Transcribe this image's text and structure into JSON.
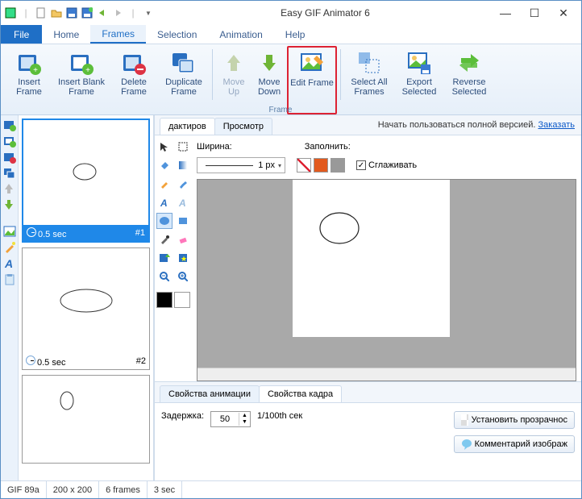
{
  "title": "Easy GIF Animator 6",
  "menu_tabs": {
    "file": "File",
    "home": "Home",
    "frames": "Frames",
    "selection": "Selection",
    "animation": "Animation",
    "help": "Help"
  },
  "ribbon": {
    "insert": "Insert Frame",
    "insert_blank": "Insert Blank Frame",
    "delete": "Delete Frame",
    "duplicate": "Duplicate Frame",
    "move_up": "Move Up",
    "move_down": "Move Down",
    "edit": "Edit Frame",
    "select_all": "Select All Frames",
    "export_sel": "Export Selected",
    "reverse_sel": "Reverse Selected",
    "group": "Frame"
  },
  "frames": [
    {
      "time": "0.5 sec",
      "index": "#1"
    },
    {
      "time": "0.5 sec",
      "index": "#2"
    }
  ],
  "editor_tabs": {
    "edit": "дактиров",
    "preview": "Просмотр"
  },
  "trial": {
    "text": "Начать пользоваться полной версией. ",
    "link": "Заказать"
  },
  "width_label": "Ширина:",
  "width_value": "1 px",
  "fill_label": "Заполнить:",
  "smooth_label": "Сглаживать",
  "prop_tabs": {
    "anim": "Свойства анимации",
    "frame": "Свойства кадра"
  },
  "prop": {
    "delay_label": "Задержка:",
    "delay_value": "50",
    "delay_unit": "1/100th сек",
    "btn_transp": "Установить прозрачнос",
    "btn_comment": "Комментарий изображ"
  },
  "status": {
    "ver": "GIF 89a",
    "size": "200 x 200",
    "frames": "6 frames",
    "dur": "3 sec"
  }
}
